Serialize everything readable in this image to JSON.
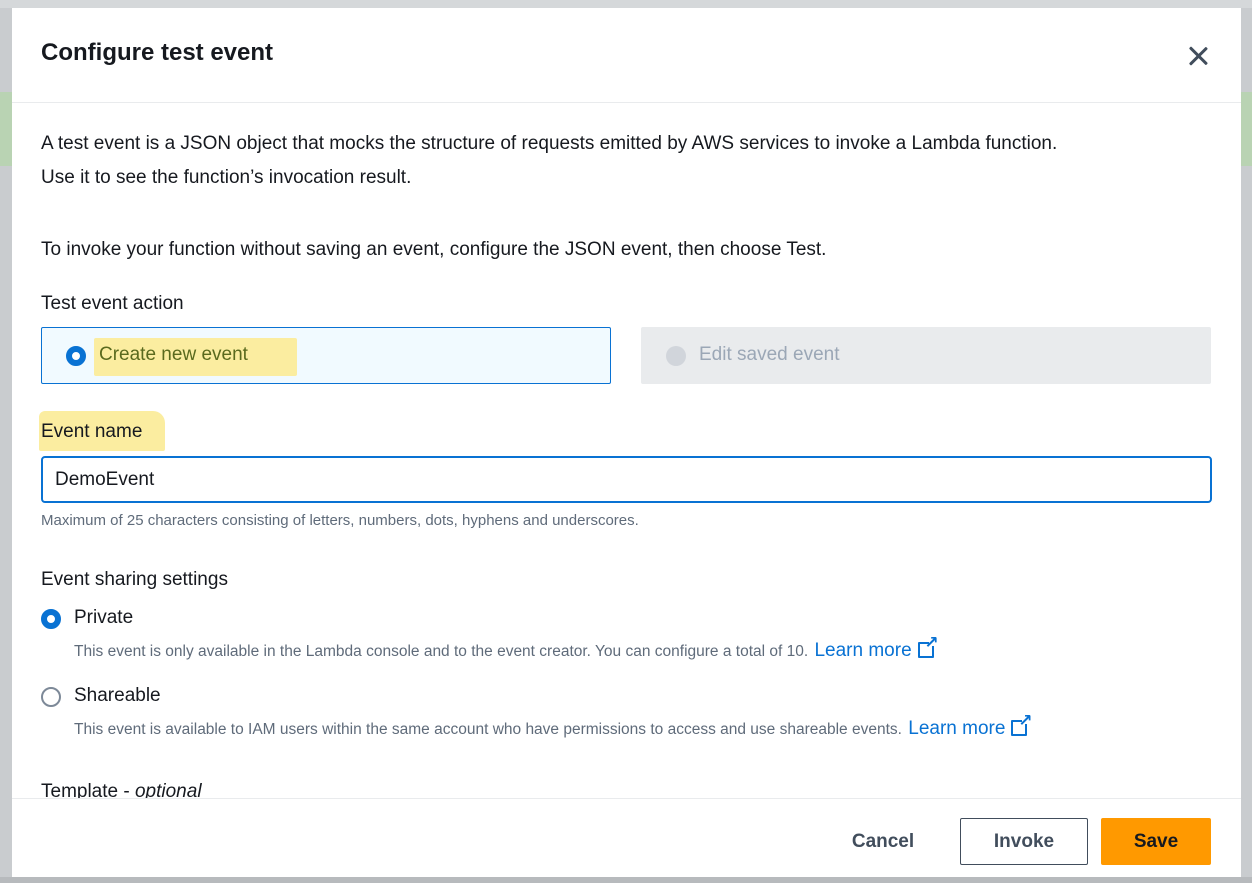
{
  "modal": {
    "title": "Configure test event",
    "intro_line1": "A test event is a JSON object that mocks the structure of requests emitted by AWS services to invoke a Lambda function.",
    "intro_line2": "Use it to see the function’s invocation result.",
    "intro_invoke": "To invoke your function without saving an event, configure the JSON event, then choose Test."
  },
  "test_event_action": {
    "label": "Test event action",
    "options": [
      {
        "label": "Create new event",
        "selected": true
      },
      {
        "label": "Edit saved event",
        "selected": false,
        "disabled": true
      }
    ]
  },
  "event_name": {
    "label": "Event name",
    "value": "DemoEvent",
    "hint": "Maximum of 25 characters consisting of letters, numbers, dots, hyphens and underscores."
  },
  "sharing": {
    "label": "Event sharing settings",
    "options": [
      {
        "label": "Private",
        "selected": true,
        "description": "This event is only available in the Lambda console and to the event creator. You can configure a total of 10.",
        "link": "Learn more"
      },
      {
        "label": "Shareable",
        "selected": false,
        "description": "This event is available to IAM users within the same account who have permissions to access and use shareable events.",
        "link": "Learn more"
      }
    ]
  },
  "template": {
    "label": "Template - ",
    "label_suffix": "optional"
  },
  "footer": {
    "cancel": "Cancel",
    "invoke": "Invoke",
    "save": "Save"
  },
  "colors": {
    "primary": "#0972d3",
    "save_button": "#ff9900",
    "highlight": "#fbeda0"
  }
}
